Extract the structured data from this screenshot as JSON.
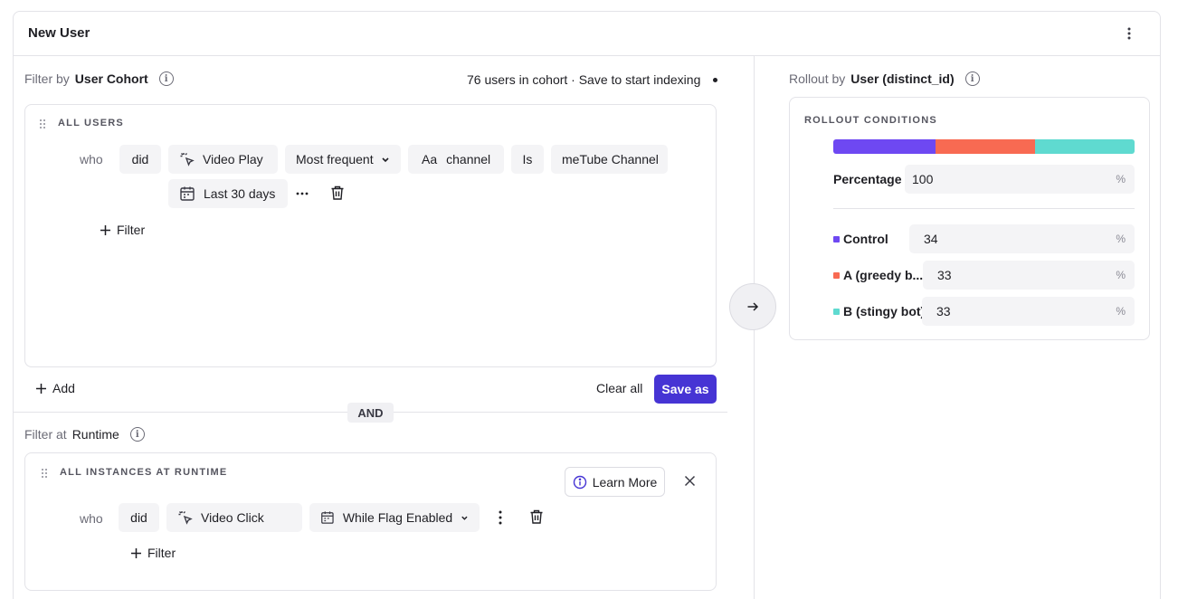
{
  "card": {
    "title": "New User"
  },
  "cohort_filter": {
    "prefix": "Filter by",
    "type": "User Cohort",
    "status": "76 users in cohort · Save to start indexing",
    "section_title": "ALL USERS",
    "who": "who",
    "did": "did",
    "event": "Video Play",
    "aggregation": "Most frequent",
    "property_prefix": "Aa",
    "property": "channel",
    "operator": "Is",
    "value": "meTube Channel",
    "date_range": "Last 30 days",
    "add_filter": "Filter",
    "add": "Add",
    "clear_all": "Clear all",
    "save_as": "Save as"
  },
  "and_label": "AND",
  "runtime_filter": {
    "prefix": "Filter at",
    "type": "Runtime",
    "section_title": "ALL INSTANCES AT RUNTIME",
    "learn_more": "Learn More",
    "who": "who",
    "did": "did",
    "event": "Video Click",
    "window": "While Flag Enabled",
    "add_filter": "Filter"
  },
  "rollout": {
    "prefix": "Rollout by",
    "type": "User (distinct_id)",
    "section_title": "ROLLOUT CONDITIONS",
    "percentage_label": "Percentage",
    "percentage_value": "100",
    "pct_symbol": "%",
    "variants": [
      {
        "label": "Control",
        "value": "34",
        "color": "#6e48f2"
      },
      {
        "label": "A (greedy b...",
        "value": "33",
        "color": "#f86a52"
      },
      {
        "label": "B (stingy bot)",
        "value": "33",
        "color": "#5fdad0"
      }
    ]
  },
  "icons": {
    "menu": "more-vertical-icon",
    "info": "info-icon",
    "grip": "drag-grip-icon",
    "event": "cursor-click-icon",
    "calendar": "calendar-icon",
    "more": "more-horizontal-icon",
    "delete": "trash-icon",
    "plus": "plus-icon",
    "arrow": "arrow-right-icon",
    "close": "close-icon",
    "chevron": "chevron-down-icon"
  }
}
